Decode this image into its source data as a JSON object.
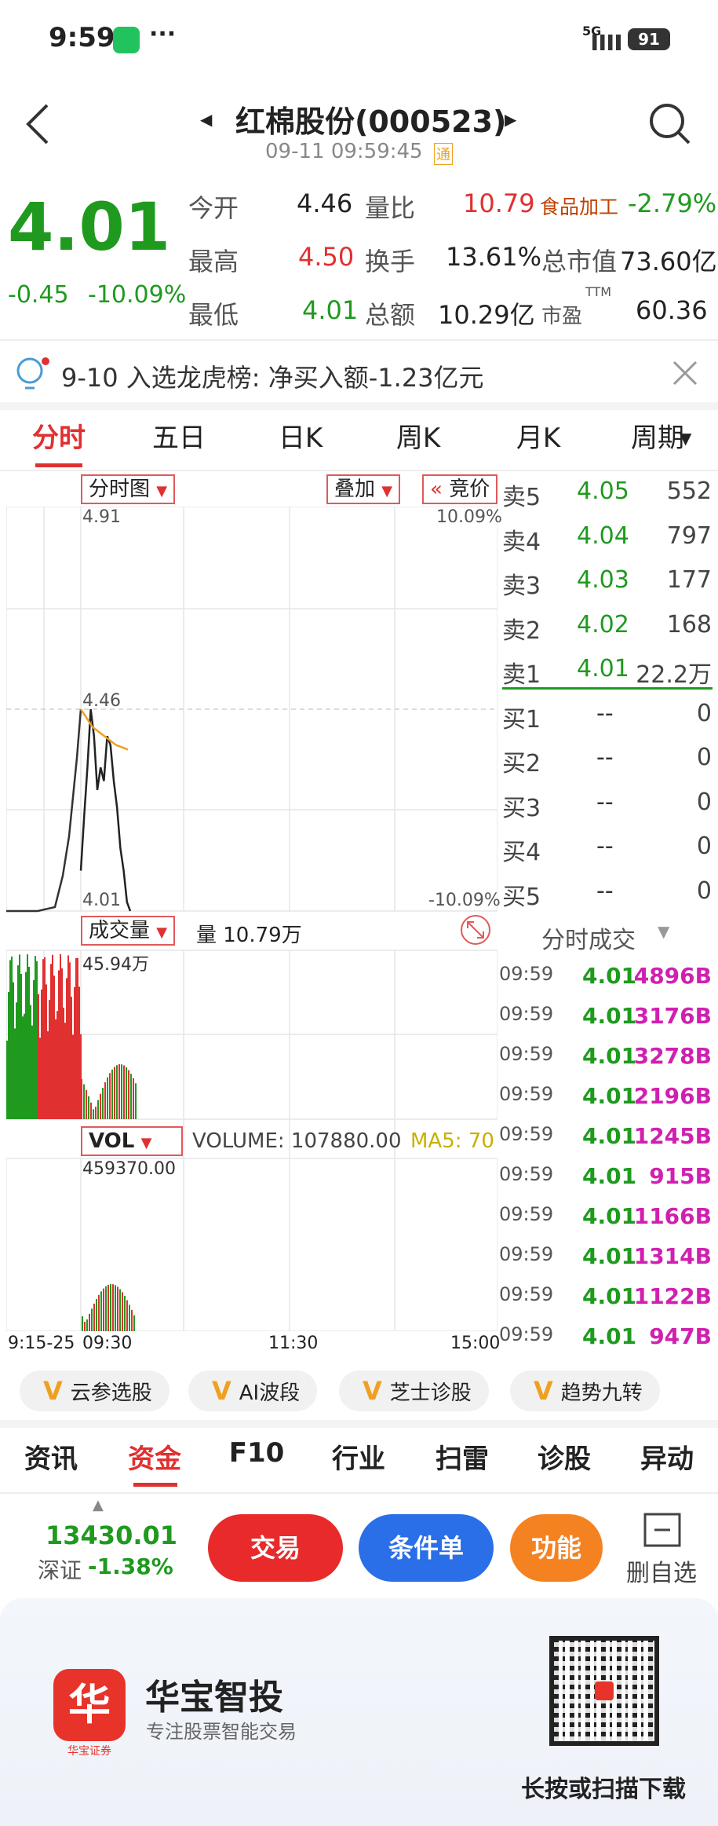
{
  "status": {
    "time": "9:59",
    "dots": "···",
    "signal": "5G",
    "battery": "91"
  },
  "header": {
    "title": "红棉股份(000523)",
    "subtitle": "09-11 09:59:45",
    "badge": "通"
  },
  "quote": {
    "price": "4.01",
    "change": "-0.45",
    "pct": "-10.09%",
    "open_l": "今开",
    "open": "4.46",
    "ratio_l": "量比",
    "ratio": "10.79",
    "sector": "食品加工",
    "sector_pct": "-2.79%",
    "high_l": "最高",
    "high": "4.50",
    "turn_l": "换手",
    "turn": "13.61%",
    "mcap_l": "总市值",
    "mcap": "73.60亿",
    "low_l": "最低",
    "low": "4.01",
    "amt_l": "总额",
    "amt": "10.29亿",
    "pe_l": "市盈",
    "pe_sup": "TTM",
    "pe": "60.36"
  },
  "notice": "9-10 入选龙虎榜: 净买入额-1.23亿元",
  "tabs": [
    "分时",
    "五日",
    "日K",
    "周K",
    "月K",
    "周期"
  ],
  "chart": {
    "sel1": "分时图",
    "sel2": "叠加",
    "sel3": "竞价",
    "top_left": "4.91",
    "top_right": "10.09%",
    "mid": "4.46",
    "bot_left": "4.01",
    "bot_right": "-10.09%",
    "vol_sel": "成交量",
    "vol_label": "量 10.79万",
    "vol_max": "45.94万",
    "ind_sel": "VOL",
    "ind_label": "VOLUME: 107880.00",
    "ma5": "MA5: 70",
    "ind_max": "459370.00",
    "t1": "9:15-25",
    "t2": "09:30",
    "t3": "11:30",
    "t4": "15:00",
    "price_line": [
      4.1,
      4.22,
      4.33,
      4.46,
      4.4,
      4.28,
      4.33,
      4.3,
      4.4,
      4.38,
      4.3,
      4.24,
      4.15,
      4.1,
      4.03,
      4.01
    ],
    "avg_line": [
      4.46,
      4.42,
      4.4,
      4.38,
      4.37
    ]
  },
  "orderbook": [
    {
      "l": "卖5",
      "p": "4.05",
      "v": "552"
    },
    {
      "l": "卖4",
      "p": "4.04",
      "v": "797"
    },
    {
      "l": "卖3",
      "p": "4.03",
      "v": "177"
    },
    {
      "l": "卖2",
      "p": "4.02",
      "v": "168"
    },
    {
      "l": "卖1",
      "p": "4.01",
      "v": "22.2万"
    },
    {
      "l": "买1",
      "p": "--",
      "v": "0"
    },
    {
      "l": "买2",
      "p": "--",
      "v": "0"
    },
    {
      "l": "买3",
      "p": "--",
      "v": "0"
    },
    {
      "l": "买4",
      "p": "--",
      "v": "0"
    },
    {
      "l": "买5",
      "p": "--",
      "v": "0"
    }
  ],
  "ticks_title": "分时成交",
  "ticks": [
    {
      "t": "09:59",
      "p": "4.01",
      "v": "4896B"
    },
    {
      "t": "09:59",
      "p": "4.01",
      "v": "3176B"
    },
    {
      "t": "09:59",
      "p": "4.01",
      "v": "3278B"
    },
    {
      "t": "09:59",
      "p": "4.01",
      "v": "2196B"
    },
    {
      "t": "09:59",
      "p": "4.01",
      "v": "1245B"
    },
    {
      "t": "09:59",
      "p": "4.01",
      "v": "915B"
    },
    {
      "t": "09:59",
      "p": "4.01",
      "v": "1166B"
    },
    {
      "t": "09:59",
      "p": "4.01",
      "v": "1314B"
    },
    {
      "t": "09:59",
      "p": "4.01",
      "v": "1122B"
    },
    {
      "t": "09:59",
      "p": "4.01",
      "v": "947B"
    }
  ],
  "vtags": [
    "云参选股",
    "AI波段",
    "芝士诊股",
    "趋势九转"
  ],
  "ntabs": [
    "资讯",
    "资金",
    "F10",
    "行业",
    "扫雷",
    "诊股",
    "异动"
  ],
  "index": {
    "value": "13430.01",
    "name": "深证",
    "pct": "-1.38%"
  },
  "actions": {
    "trade": "交易",
    "cond": "条件单",
    "func": "功能",
    "remove": "删自选"
  },
  "ad": {
    "brand": "华宝智投",
    "slogan": "专注股票智能交易",
    "logo_sub": "华宝证券",
    "qr_text": "长按或扫描下载"
  }
}
